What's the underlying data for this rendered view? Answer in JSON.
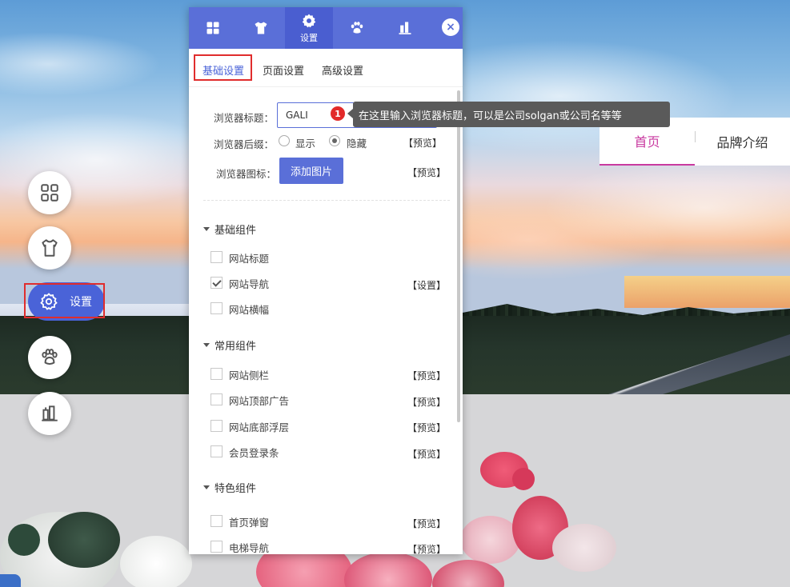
{
  "nav": {
    "items": [
      "首页",
      "品牌介绍"
    ],
    "active_index": 0
  },
  "float_menu": {
    "settings_label": "设置"
  },
  "panel": {
    "tabs": [
      {
        "icon": "grid-icon",
        "label": ""
      },
      {
        "icon": "shirt-icon",
        "label": ""
      },
      {
        "icon": "gear-icon",
        "label": "设置"
      },
      {
        "icon": "paw-icon",
        "label": ""
      },
      {
        "icon": "tools-icon",
        "label": ""
      }
    ],
    "active_tab": 2,
    "close_label": "×",
    "subtabs": [
      "基础设置",
      "页面设置",
      "高级设置"
    ],
    "active_subtab": 0,
    "browser_title_label": "浏览器标题：",
    "browser_title_value": "GALI",
    "browser_suffix_label": "浏览器后缀：",
    "suffix_options": [
      "显示",
      "隐藏"
    ],
    "suffix_selected": "隐藏",
    "preview_link": "【预览】",
    "browser_icon_label": "浏览器图标：",
    "add_image_label": "添加图片",
    "groups": [
      {
        "title": "基础组件",
        "items": [
          {
            "label": "网站标题",
            "checked": false,
            "action": ""
          },
          {
            "label": "网站导航",
            "checked": true,
            "action": "【设置】"
          },
          {
            "label": "网站横幅",
            "checked": false,
            "action": ""
          }
        ]
      },
      {
        "title": "常用组件",
        "items": [
          {
            "label": "网站侧栏",
            "checked": false,
            "action": "【预览】"
          },
          {
            "label": "网站顶部广告",
            "checked": false,
            "action": "【预览】"
          },
          {
            "label": "网站底部浮层",
            "checked": false,
            "action": "【预览】"
          },
          {
            "label": "会员登录条",
            "checked": false,
            "action": "【预览】"
          }
        ]
      },
      {
        "title": "特色组件",
        "items": [
          {
            "label": "首页弹窗",
            "checked": false,
            "action": "【预览】"
          },
          {
            "label": "电梯导航",
            "checked": false,
            "action": "【预览】"
          }
        ]
      }
    ]
  },
  "tooltip": {
    "badge": "1",
    "text": "在这里输入浏览器标题，可以是公司solgan或公司名等等"
  },
  "colors": {
    "accent": "#5a6fd8",
    "highlight_box": "#e02d2d",
    "nav_active": "#c93aa0",
    "tooltip_bg": "#5a5a5a"
  }
}
